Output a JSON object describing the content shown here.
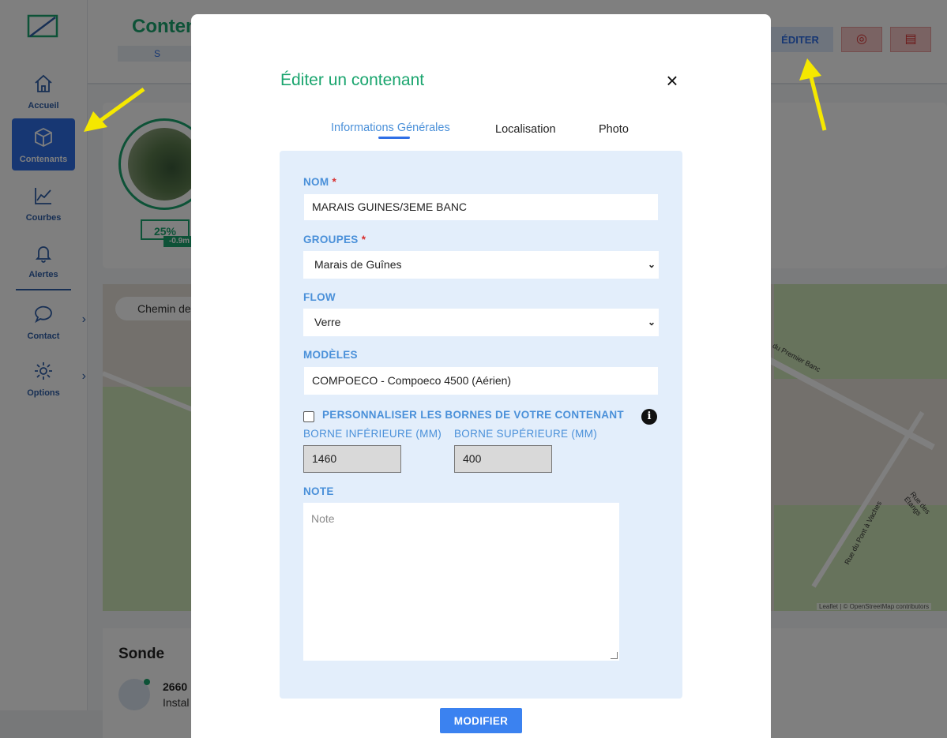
{
  "sidebar": {
    "items": [
      {
        "label": "Accueil",
        "icon": "home-icon"
      },
      {
        "label": "Contenants",
        "icon": "box-icon"
      },
      {
        "label": "Courbes",
        "icon": "chart-line-icon"
      },
      {
        "label": "Alertes",
        "icon": "bell-icon"
      },
      {
        "label": "Contact",
        "icon": "chat-bubble-icon"
      },
      {
        "label": "Options",
        "icon": "gear-icon"
      }
    ]
  },
  "header": {
    "title": "Conten",
    "sub": "S",
    "editer_label": "ÉDITER"
  },
  "container_card": {
    "fill_pct": "25%",
    "delta": "-0.9m"
  },
  "map": {
    "search_chip": "Chemin de",
    "street_1": "du Premier Banc",
    "street_2": "Rue des Étangs",
    "street_3": "Rue du Pont à Vaches",
    "attribution": "Leaflet | © OpenStreetMap contributors"
  },
  "sonde": {
    "title": "Sonde",
    "id": "2660",
    "install": "Instal"
  },
  "modal": {
    "title": "Éditer un contenant",
    "tabs": [
      "Informations Générales",
      "Localisation",
      "Photo"
    ],
    "form": {
      "nom_label": "NOM",
      "nom_value": "MARAIS GUINES/3EME BANC",
      "groupes_label": "GROUPES",
      "groupes_value": "Marais de Guînes",
      "flow_label": "FLOW",
      "flow_value": "Verre",
      "modeles_label": "MODÈLES",
      "modeles_value": "COMPOECO - Compoeco 4500 (Aérien)",
      "custom_bounds_label": "PERSONNALISER LES BORNES DE VOTRE CONTENANT",
      "lower_label": "BORNE INFÉRIEURE (MM)",
      "lower_value": "1460",
      "upper_label": "BORNE SUPÉRIEURE (MM)",
      "upper_value": "400",
      "note_label": "NOTE",
      "note_placeholder": "Note",
      "required_mark": "*"
    },
    "submit_label": "MODIFIER"
  },
  "colors": {
    "brand_green": "#1aa56e",
    "primary_blue": "#2f6fe6",
    "label_blue": "#4a90d9",
    "annotation_yellow": "#f5e800"
  }
}
